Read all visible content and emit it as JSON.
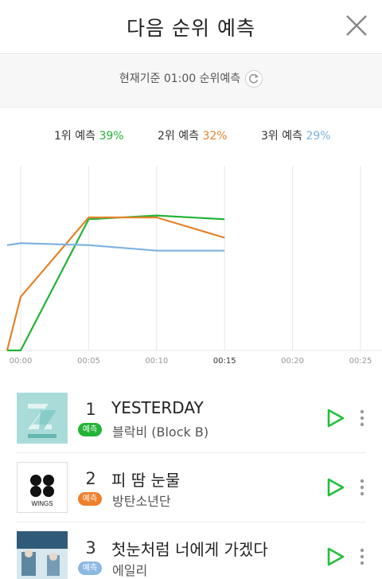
{
  "header": {
    "title": "다음 순위 예측",
    "close_icon": "close-icon"
  },
  "basis": {
    "text": "현재기준 01:00 순위예측",
    "refresh_icon": "refresh-icon"
  },
  "legend": [
    {
      "label": "1위 예측",
      "pct": "39%",
      "color": "#22b336"
    },
    {
      "label": "2위 예측",
      "pct": "32%",
      "color": "#e2832a"
    },
    {
      "label": "3위 예측",
      "pct": "29%",
      "color": "#7fb2e0"
    }
  ],
  "chart_data": {
    "type": "line",
    "x": [
      "00:00",
      "00:05",
      "00:10",
      "00:15",
      "00:20",
      "00:25"
    ],
    "highlight_tick": "00:15",
    "grid": true,
    "series": [
      {
        "color": "#22b336",
        "points": [
          [
            "-00:01",
            0
          ],
          [
            "00:00",
            0
          ],
          [
            "00:05",
            71
          ],
          [
            "00:10",
            73
          ],
          [
            "00:15",
            71
          ]
        ]
      },
      {
        "color": "#e2832a",
        "points": [
          [
            "-00:01",
            0
          ],
          [
            "00:00",
            29
          ],
          [
            "00:05",
            72
          ],
          [
            "00:10",
            72
          ],
          [
            "00:15",
            61
          ]
        ]
      },
      {
        "color": "#7fb2e0",
        "points": [
          [
            "-00:01",
            57
          ],
          [
            "00:00",
            58
          ],
          [
            "00:05",
            57
          ],
          [
            "00:10",
            54
          ],
          [
            "00:15",
            54
          ]
        ]
      }
    ]
  },
  "songs": [
    {
      "rank": "1",
      "badge": "예측",
      "badge_color": "#22b336",
      "title": "YESTERDAY",
      "artist": "블락비 (Block B)",
      "cover_text": "YESTERDAY"
    },
    {
      "rank": "2",
      "badge": "예측",
      "badge_color": "#f07f2a",
      "title": "피 땀 눈물",
      "artist": "방탄소년단",
      "cover_text": "WINGS"
    },
    {
      "rank": "3",
      "badge": "예측",
      "badge_color": "#8cb8e4",
      "title": "첫눈처럼 너에게 가겠다",
      "artist": "에일리",
      "cover_text": ""
    }
  ],
  "icons": {
    "play": "play-icon",
    "more": "more-vertical-icon"
  }
}
